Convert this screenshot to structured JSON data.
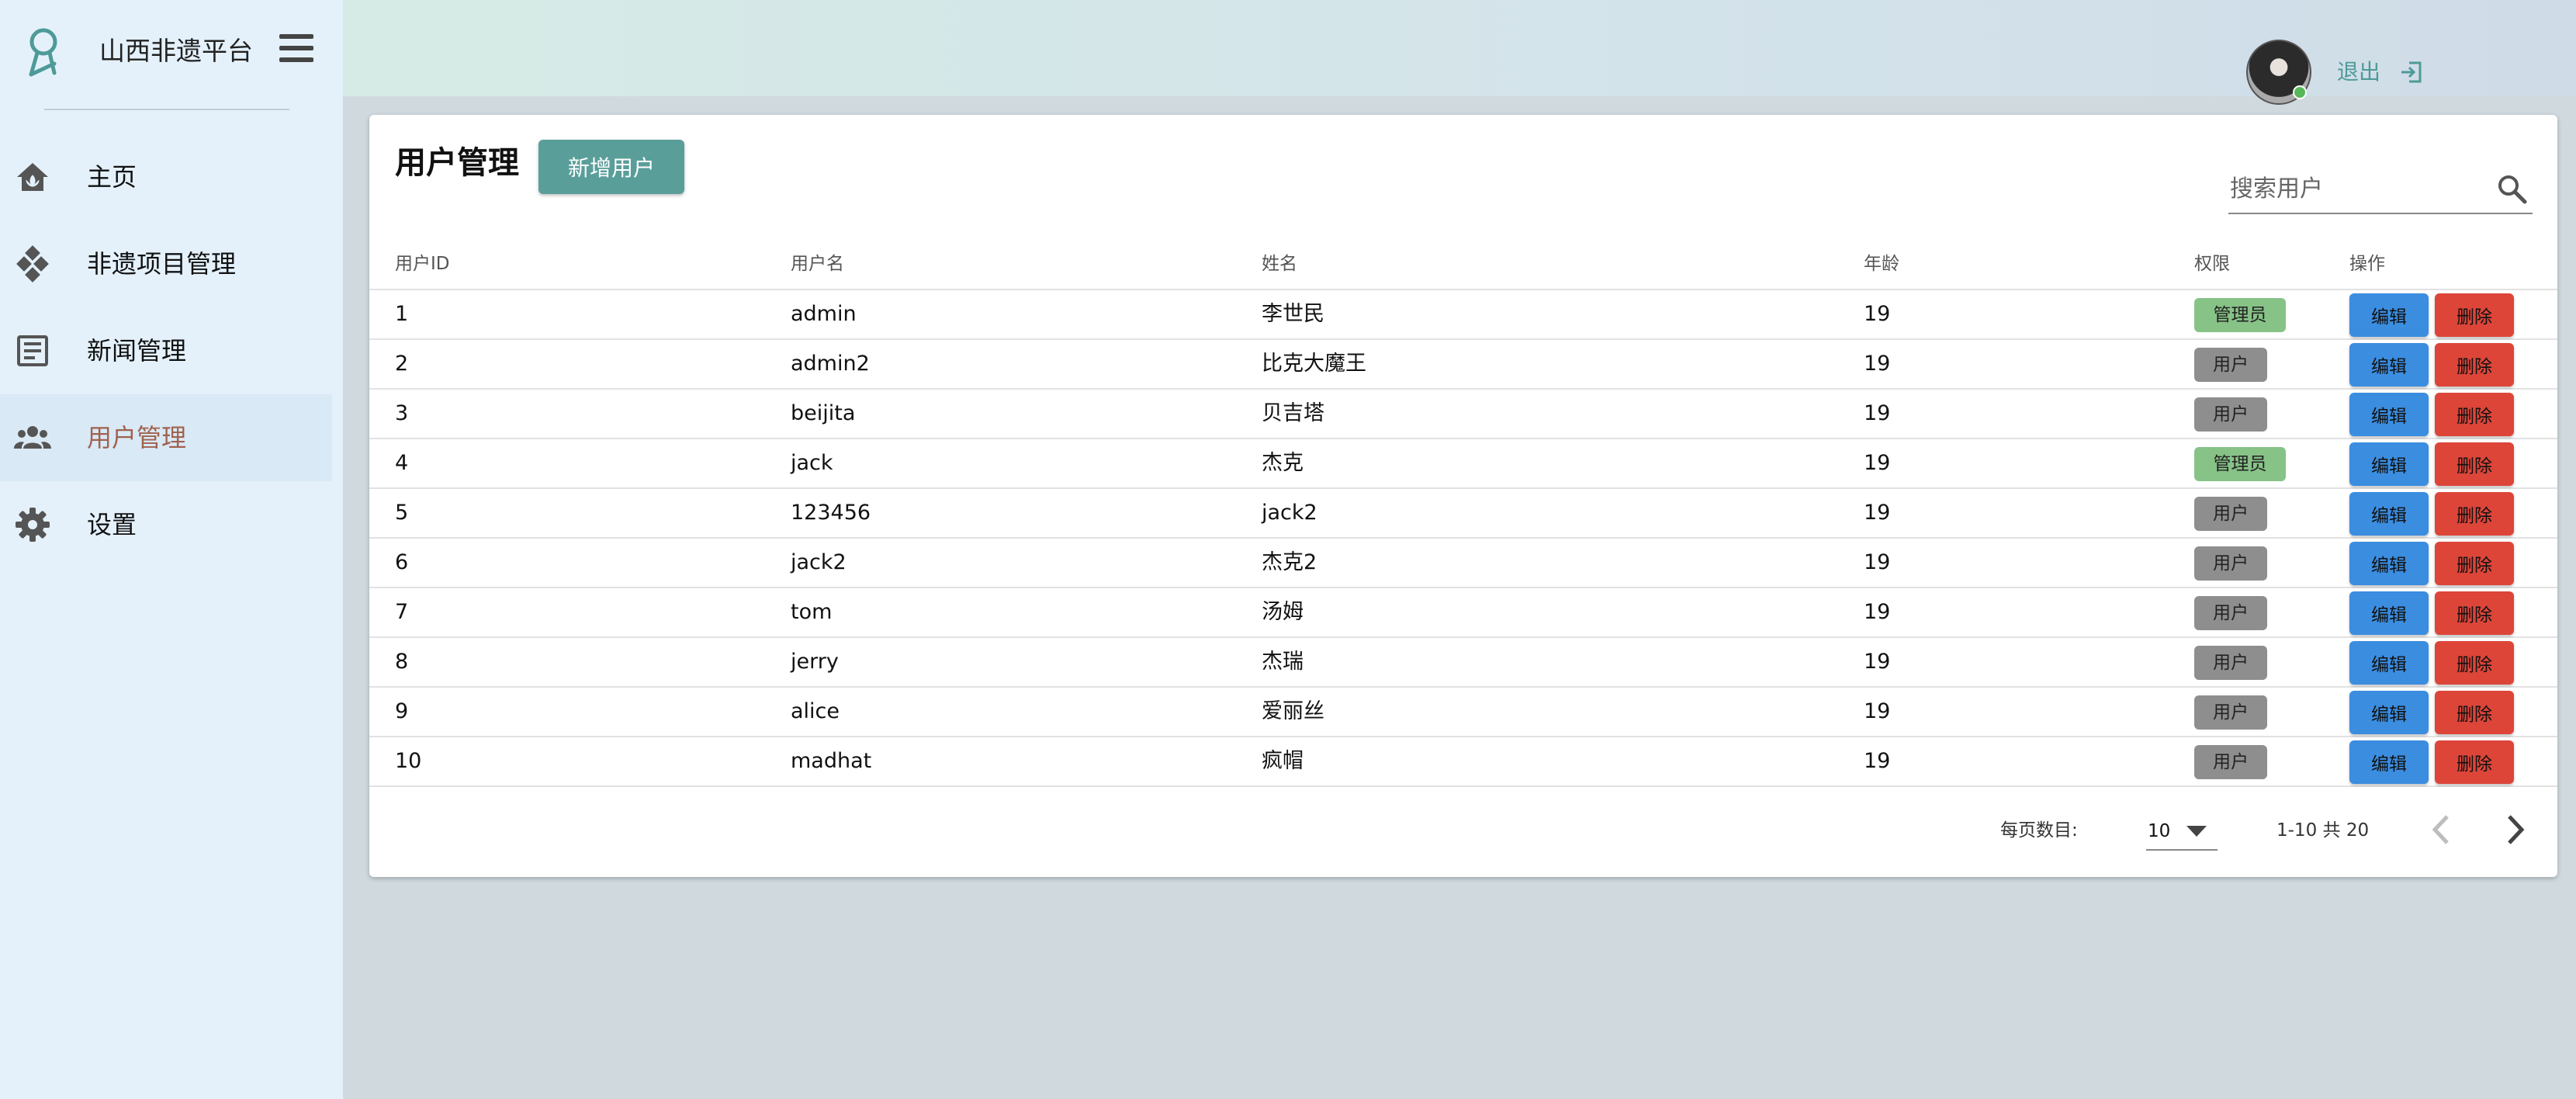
{
  "sidebar": {
    "title": "山西非遗平台",
    "items": [
      {
        "label": "主页",
        "icon": "home-icon",
        "active": false
      },
      {
        "label": "非遗项目管理",
        "icon": "diamond-grid-icon",
        "active": false
      },
      {
        "label": "新闻管理",
        "icon": "news-icon",
        "active": false
      },
      {
        "label": "用户管理",
        "icon": "people-icon",
        "active": true
      },
      {
        "label": "设置",
        "icon": "gear-icon",
        "active": false
      }
    ]
  },
  "header": {
    "logout_label": "退出"
  },
  "page": {
    "title": "用户管理",
    "add_button": "新增用户",
    "search_placeholder": "搜索用户"
  },
  "table": {
    "columns": [
      "用户ID",
      "用户名",
      "姓名",
      "年龄",
      "权限",
      "操作"
    ],
    "edit_label": "编辑",
    "delete_label": "删除",
    "rows": [
      {
        "id": "1",
        "username": "admin",
        "name": "李世民",
        "age": "19",
        "role": "管理员",
        "role_type": "admin"
      },
      {
        "id": "2",
        "username": "admin2",
        "name": "比克大魔王",
        "age": "19",
        "role": "用户",
        "role_type": "user"
      },
      {
        "id": "3",
        "username": "beijita",
        "name": "贝吉塔",
        "age": "19",
        "role": "用户",
        "role_type": "user"
      },
      {
        "id": "4",
        "username": "jack",
        "name": "杰克",
        "age": "19",
        "role": "管理员",
        "role_type": "admin"
      },
      {
        "id": "5",
        "username": "123456",
        "name": "jack2",
        "age": "19",
        "role": "用户",
        "role_type": "user"
      },
      {
        "id": "6",
        "username": "jack2",
        "name": "杰克2",
        "age": "19",
        "role": "用户",
        "role_type": "user"
      },
      {
        "id": "7",
        "username": "tom",
        "name": "汤姆",
        "age": "19",
        "role": "用户",
        "role_type": "user"
      },
      {
        "id": "8",
        "username": "jerry",
        "name": "杰瑞",
        "age": "19",
        "role": "用户",
        "role_type": "user"
      },
      {
        "id": "9",
        "username": "alice",
        "name": "爱丽丝",
        "age": "19",
        "role": "用户",
        "role_type": "user"
      },
      {
        "id": "10",
        "username": "madhat",
        "name": "疯帽",
        "age": "19",
        "role": "用户",
        "role_type": "user"
      }
    ]
  },
  "pagination": {
    "per_page_label": "每页数目:",
    "per_page_value": "10",
    "range_text": "1-10 共 20"
  },
  "colors": {
    "accent": "#5a9e9a",
    "edit": "#3b8de0",
    "delete": "#dd4539",
    "admin_badge": "#87c287",
    "user_badge": "#8e8e8e"
  }
}
